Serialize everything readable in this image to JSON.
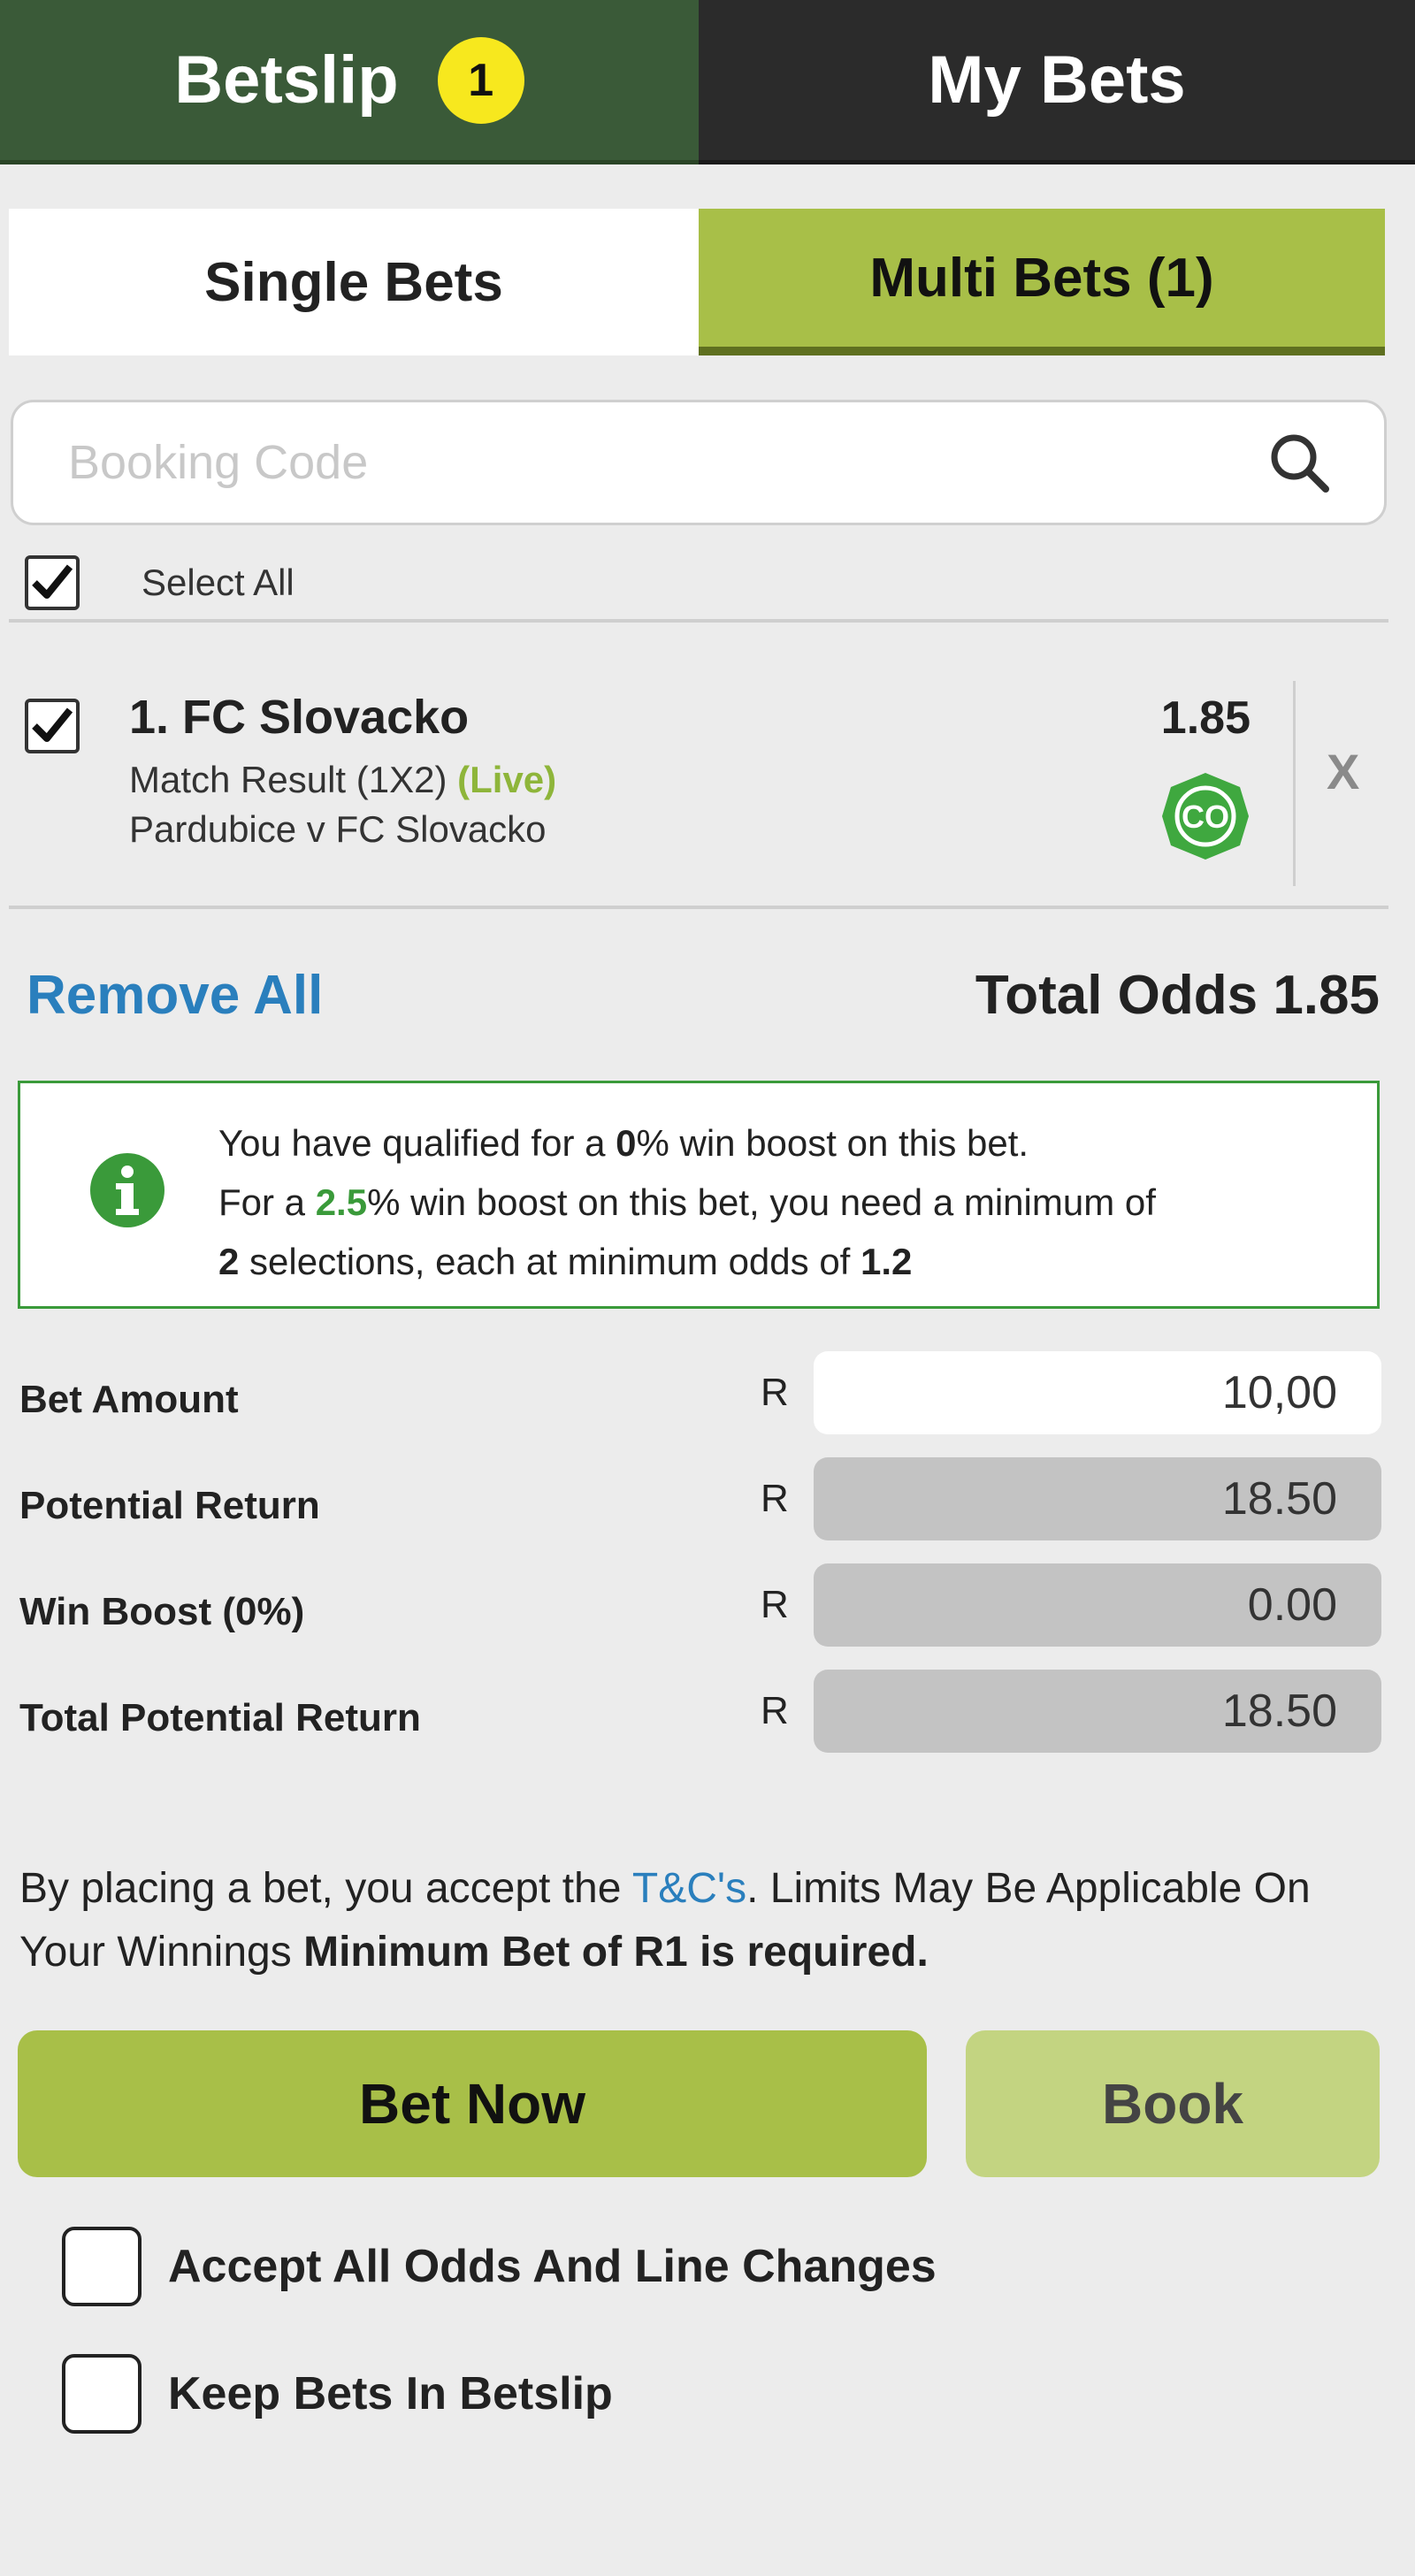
{
  "tabs": {
    "betslip_label": "Betslip",
    "betslip_count": "1",
    "mybets_label": "My Bets"
  },
  "bet_type_tabs": {
    "single_label": "Single Bets",
    "multi_label": "Multi Bets (1)",
    "active": "multi"
  },
  "booking": {
    "placeholder": "Booking Code",
    "value": ""
  },
  "select_all": {
    "label": "Select All",
    "checked": true
  },
  "selection": {
    "name": "1. FC Slovacko",
    "market": "Match Result (1X2)",
    "live_tag": "(Live)",
    "event": "Pardubice v FC Slovacko",
    "odds": "1.85",
    "badge_icon": "co-cashout-icon",
    "remove_label": "X",
    "checked": true
  },
  "summary": {
    "remove_all_label": "Remove All",
    "total_odds_label": "Total Odds 1.85"
  },
  "info": {
    "icon": "info-icon",
    "line1_pre": "You have qualified for a ",
    "line1_pct": "0",
    "line1_post": "% win boost on this bet.",
    "line2_pre": "For a ",
    "line2_pct": "2.5",
    "line2_post": "% win boost on this bet, you need a minimum of",
    "line3_num": "2",
    "line3_mid": " selections, each at minimum odds of ",
    "line3_odds": "1.2"
  },
  "bet": {
    "currency": "R",
    "amount_label": "Bet Amount",
    "amount_value": "10,00",
    "potential_label": "Potential Return",
    "potential_value": "18.50",
    "boost_label": "Win Boost (0%)",
    "boost_value": "0.00",
    "total_label": "Total Potential Return",
    "total_value": "18.50"
  },
  "terms": {
    "pre": "By placing a bet, you accept the ",
    "link": "T&C's",
    "post": ". Limits May Be Applicable On Your Winnings ",
    "bold": "Minimum Bet of R1 is required."
  },
  "actions": {
    "bet_now_label": "Bet Now",
    "book_label": "Book"
  },
  "options": {
    "accept_changes_label": "Accept All Odds And Line Changes",
    "accept_changes_checked": false,
    "keep_bets_label": "Keep Bets In Betslip",
    "keep_bets_checked": false
  },
  "colors": {
    "betslip_tab": "#3a5a38",
    "mybets_tab": "#2b2b2b",
    "accent_green": "#a8bf48",
    "link_blue": "#2a7fbd",
    "badge_yellow": "#f7e81e",
    "info_green": "#3a9a3a"
  }
}
